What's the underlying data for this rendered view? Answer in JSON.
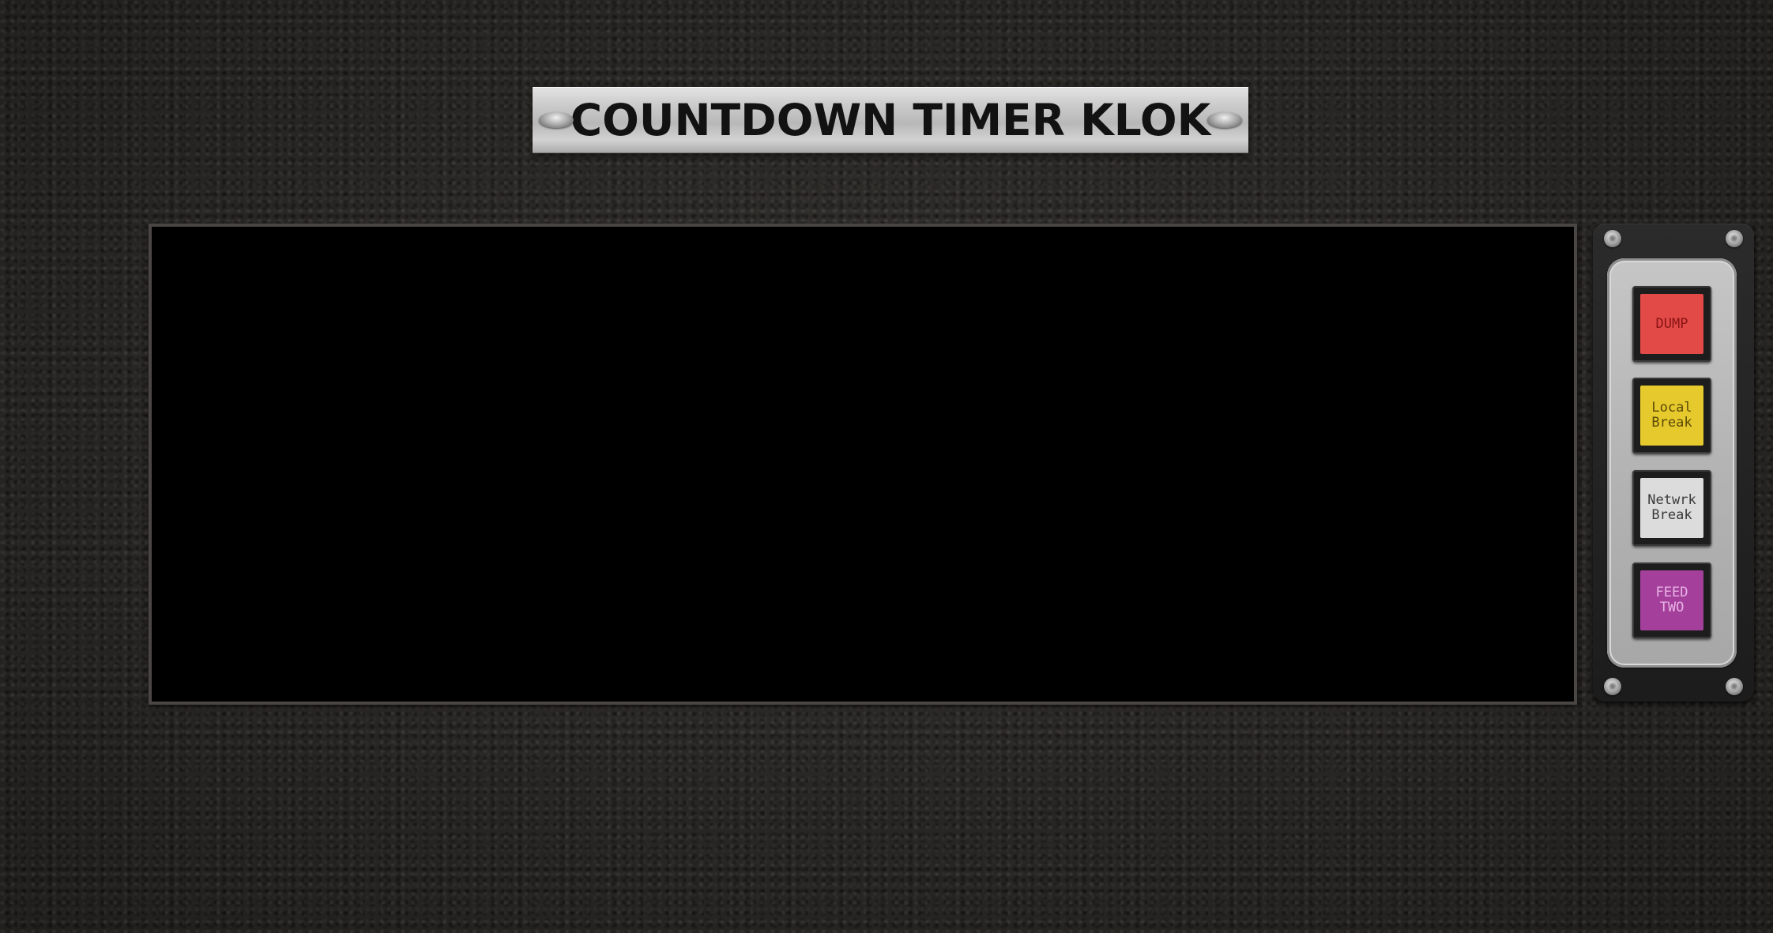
{
  "title": "COUNTDOWN TIMER KLOK",
  "buttons": [
    {
      "label": "DUMP",
      "color": "#e24a48",
      "text_color": "#8a1414"
    },
    {
      "label": "Local\nBreak",
      "color": "#e6c92c",
      "text_color": "#5a4a06"
    },
    {
      "label": "Netwrk\nBreak",
      "color": "#dcdcdc",
      "text_color": "#3a3a3a"
    },
    {
      "label": "FEED\nTWO",
      "color": "#a4409c",
      "text_color": "#e8b4e4"
    }
  ]
}
